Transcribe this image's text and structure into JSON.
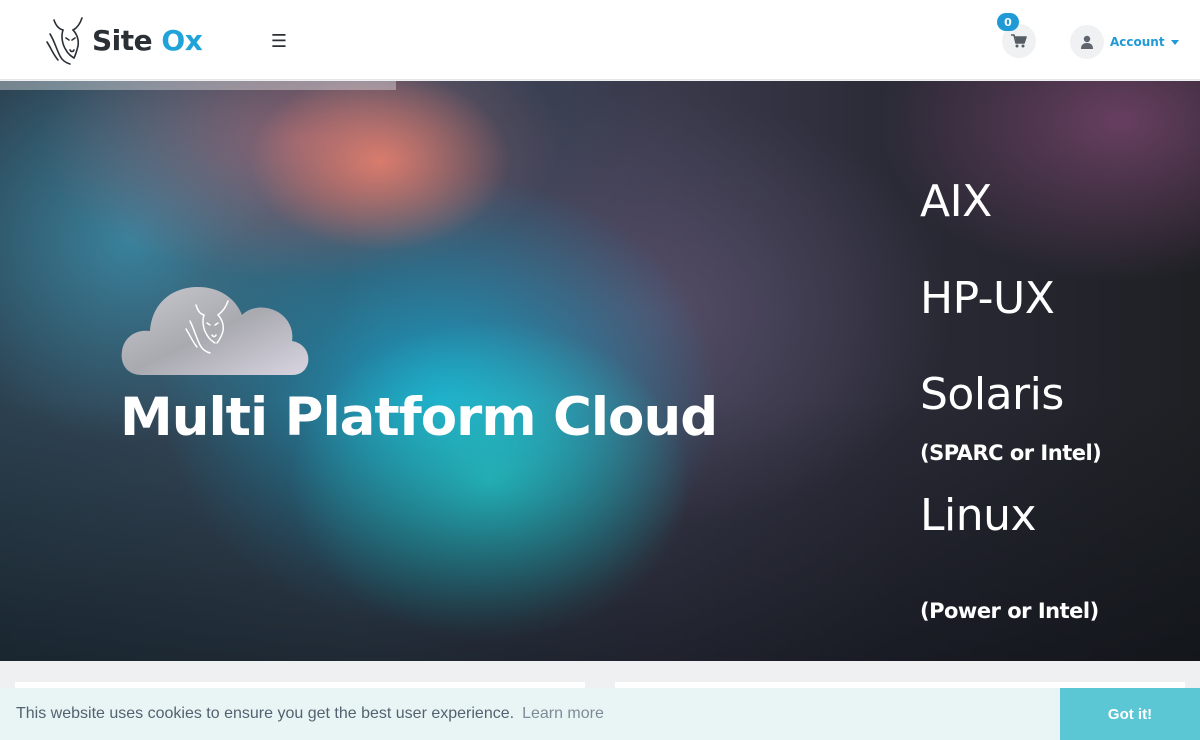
{
  "header": {
    "logo": {
      "word1": "Site",
      "word2": "Ox",
      "icon": "ox-head-icon"
    },
    "menu_glyph": "☰",
    "cart": {
      "count": "0",
      "icon": "shopping-cart-icon"
    },
    "account": {
      "label": "Account",
      "icon": "user-icon"
    }
  },
  "hero": {
    "title": "Multi Platform Cloud",
    "cloud_icon": "cloud-ox-logo-icon",
    "platforms": [
      {
        "name": "AIX"
      },
      {
        "name": "HP-UX"
      },
      {
        "name": "Solaris",
        "note": "(SPARC or Intel)"
      },
      {
        "name": "Linux",
        "note": "(Power or Intel)"
      }
    ],
    "slide_progress": 0.33
  },
  "cookie": {
    "message": "This website uses cookies to ensure you get the best user experience.",
    "link": "Learn more",
    "button": "Got it!"
  },
  "colors": {
    "brand_blue": "#1fa3d8",
    "accent_blue": "#1f9ad6",
    "cookie_bg": "#e9f5f5",
    "cookie_button": "#5bc6d4",
    "dark_text": "#2b3036"
  }
}
